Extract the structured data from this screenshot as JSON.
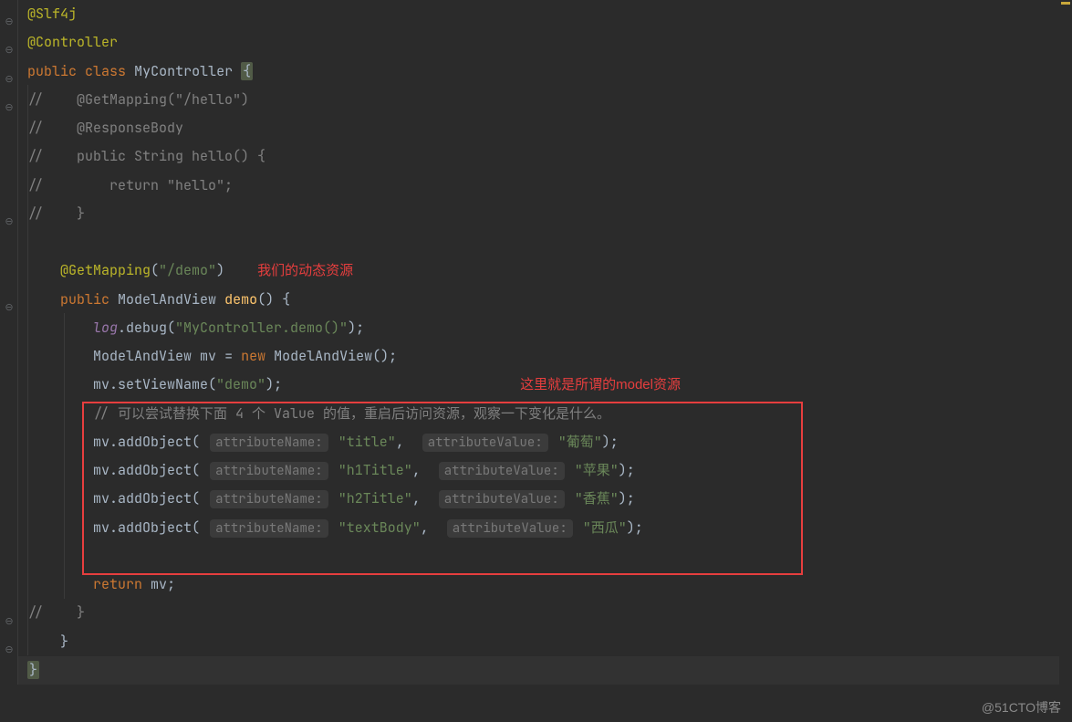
{
  "watermark": "@51CTO博客",
  "annotations": {
    "dynamic_resource": "我们的动态资源",
    "model_resource": "这里就是所谓的model资源"
  },
  "code": {
    "anno_slf4j": "@Slf4j",
    "anno_controller": "@Controller",
    "kw_public": "public",
    "kw_class": "class",
    "class_name": "MyController",
    "brace_open": "{",
    "brace_close": "}",
    "c1": "//    @GetMapping(\"/hello\")",
    "c2": "//    @ResponseBody",
    "c3": "//    public String hello() {",
    "c4": "//        return \"hello\";",
    "c5": "//    }",
    "anno_getmapping": "@GetMapping",
    "path_demo": "\"/demo\"",
    "ret_type": "ModelAndView",
    "method_demo": "demo",
    "log_field": "log",
    "debug_call": ".debug(",
    "debug_arg": "\"MyController.demo()\"",
    "mv_decl_type": "ModelAndView",
    "mv_var": "mv",
    "kw_new": "new",
    "ctor": "ModelAndView",
    "setview": ".setViewName(",
    "view_arg": "\"demo\"",
    "cmt_try": "// 可以尝试替换下面 4 个 Value 的值，重启后访问资源，观察一下变化是什么。",
    "addobj": ".addObject(",
    "hint_name": "attributeName:",
    "hint_val": "attributeValue:",
    "v_title_k": "\"title\"",
    "v_title_v": "\"葡萄\"",
    "v_h1_k": "\"h1Title\"",
    "v_h1_v": "\"苹果\"",
    "v_h2_k": "\"h2Title\"",
    "v_h2_v": "\"香蕉\"",
    "v_tb_k": "\"textBody\"",
    "v_tb_v": "\"西瓜\"",
    "kw_return": "return",
    "cmt_end1": "//    }",
    "semi": ";",
    "paren_close": ")",
    "eq": " = ",
    "comma": ","
  }
}
